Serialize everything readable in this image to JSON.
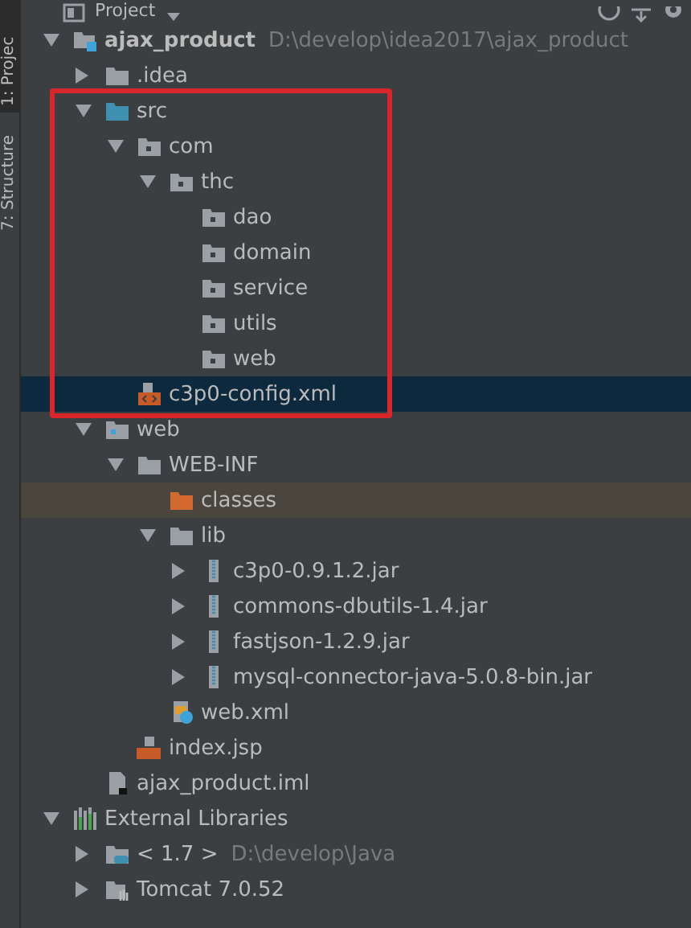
{
  "side_tabs": [
    {
      "label": "1: Projec",
      "selected": true
    },
    {
      "label": "7: Structure",
      "selected": false
    }
  ],
  "header": {
    "title": "Project"
  },
  "annotation_frame": {
    "shown": true
  },
  "tree": [
    {
      "name": "ajax_product",
      "path": "D:\\develop\\idea2017\\ajax_product",
      "kind": "module",
      "expanded": true,
      "selected": false,
      "highlighted": false,
      "children": [
        {
          "name": ".idea",
          "kind": "folder",
          "expanded": false,
          "selected": false,
          "highlighted": false
        },
        {
          "name": "src",
          "kind": "source",
          "expanded": true,
          "selected": false,
          "highlighted": false,
          "children": [
            {
              "name": "com",
              "kind": "package",
              "expanded": true,
              "selected": false,
              "highlighted": false,
              "children": [
                {
                  "name": "thc",
                  "kind": "package",
                  "expanded": true,
                  "selected": false,
                  "highlighted": false,
                  "children": [
                    {
                      "name": "dao",
                      "kind": "package",
                      "selected": false,
                      "highlighted": false
                    },
                    {
                      "name": "domain",
                      "kind": "package",
                      "selected": false,
                      "highlighted": false
                    },
                    {
                      "name": "service",
                      "kind": "package",
                      "selected": false,
                      "highlighted": false
                    },
                    {
                      "name": "utils",
                      "kind": "package",
                      "selected": false,
                      "highlighted": false
                    },
                    {
                      "name": "web",
                      "kind": "package",
                      "selected": false,
                      "highlighted": false
                    }
                  ]
                }
              ]
            },
            {
              "name": "c3p0-config.xml",
              "kind": "xml",
              "selected": true,
              "highlighted": false
            }
          ]
        },
        {
          "name": "web",
          "kind": "web",
          "expanded": true,
          "selected": false,
          "highlighted": false,
          "children": [
            {
              "name": "WEB-INF",
              "kind": "folder",
              "expanded": true,
              "selected": false,
              "highlighted": false,
              "children": [
                {
                  "name": "classes",
                  "kind": "excluded",
                  "selected": false,
                  "highlighted": true
                },
                {
                  "name": "lib",
                  "kind": "folder",
                  "expanded": true,
                  "selected": false,
                  "highlighted": false,
                  "children": [
                    {
                      "name": "c3p0-0.9.1.2.jar",
                      "kind": "jar",
                      "expanded": false,
                      "selected": false,
                      "highlighted": false
                    },
                    {
                      "name": "commons-dbutils-1.4.jar",
                      "kind": "jar",
                      "expanded": false,
                      "selected": false,
                      "highlighted": false
                    },
                    {
                      "name": "fastjson-1.2.9.jar",
                      "kind": "jar",
                      "expanded": false,
                      "selected": false,
                      "highlighted": false
                    },
                    {
                      "name": "mysql-connector-java-5.0.8-bin.jar",
                      "kind": "jar",
                      "expanded": false,
                      "selected": false,
                      "highlighted": false
                    }
                  ]
                },
                {
                  "name": "web.xml",
                  "kind": "webxml",
                  "selected": false,
                  "highlighted": false
                }
              ]
            },
            {
              "name": "index.jsp",
              "kind": "jsp",
              "selected": false,
              "highlighted": false
            }
          ]
        },
        {
          "name": "ajax_product.iml",
          "kind": "iml",
          "selected": false,
          "highlighted": false
        }
      ]
    },
    {
      "name": "External Libraries",
      "kind": "libraries",
      "expanded": true,
      "selected": false,
      "highlighted": false,
      "children": [
        {
          "name": "< 1.7 >",
          "path": "D:\\develop\\Java",
          "kind": "jdk",
          "expanded": false,
          "selected": false,
          "highlighted": false
        },
        {
          "name": "Tomcat 7.0.52",
          "kind": "tomcat",
          "expanded": false,
          "selected": false,
          "highlighted": false
        }
      ]
    }
  ]
}
